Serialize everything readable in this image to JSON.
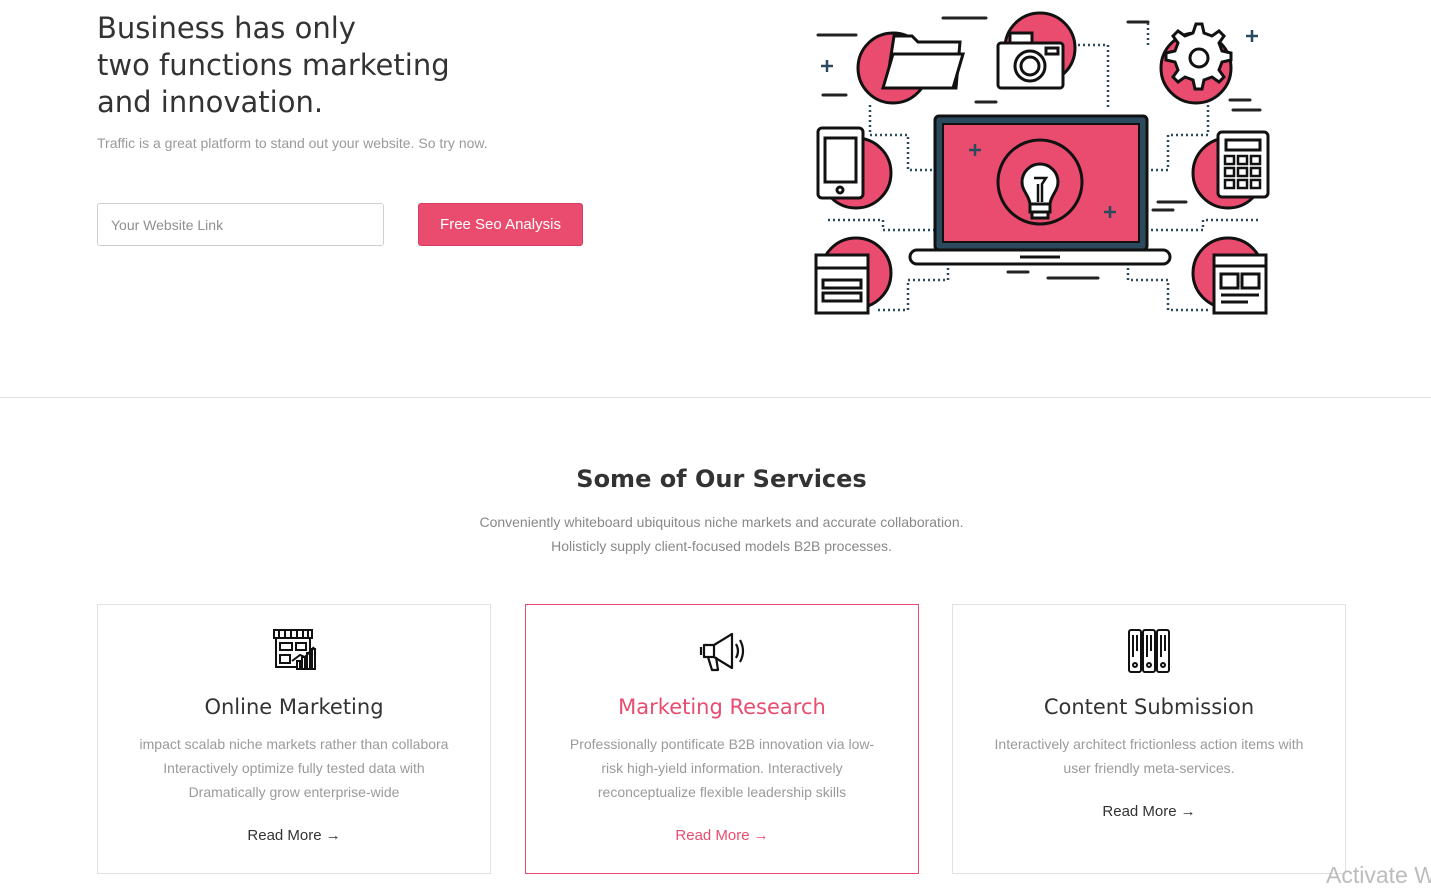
{
  "hero": {
    "title_line1": "Business has only",
    "title_line2": "two functions marketing",
    "title_line3": "and innovation.",
    "subtitle": "Traffic is a great platform to stand out your website. So try now.",
    "input_placeholder": "Your Website Link",
    "button_label": "Free Seo Analysis",
    "illustration_icons": [
      "folder-icon",
      "camera-icon",
      "gear-icon",
      "mobile-phone-icon",
      "laptop-icon",
      "lightbulb-icon",
      "calculator-icon",
      "browser-window-icon",
      "layout-window-icon"
    ]
  },
  "services": {
    "title": "Some of Our Services",
    "desc_line1": "Conveniently whiteboard ubiquitous niche markets and accurate collaboration.",
    "desc_line2": "Holisticly supply client-focused models B2B processes.",
    "cards": [
      {
        "icon": "storefront-chart-icon",
        "title": "Online Marketing",
        "line1": "impact scalab niche markets rather than collabora",
        "line2": "Interactively optimize fully tested data with",
        "line3": "Dramatically grow enterprise-wide",
        "link": "Read More",
        "active": false
      },
      {
        "icon": "megaphone-icon",
        "title": "Marketing Research",
        "line1": "Professionally pontificate B2B innovation via low-",
        "line2": "risk high-yield information. Interactively",
        "line3": "reconceptualize flexible leadership skills",
        "link": "Read More",
        "active": true
      },
      {
        "icon": "server-rack-icon",
        "title": "Content Submission",
        "line1": "Interactively architect frictionless action items with",
        "line2": "user friendly meta-services.",
        "link": "Read More",
        "active": false
      }
    ]
  },
  "colors": {
    "accent": "#ea4c6f",
    "text": "#333333",
    "muted": "#9a9a9a",
    "border": "#e2e2e2"
  },
  "watermark": "Activate W"
}
